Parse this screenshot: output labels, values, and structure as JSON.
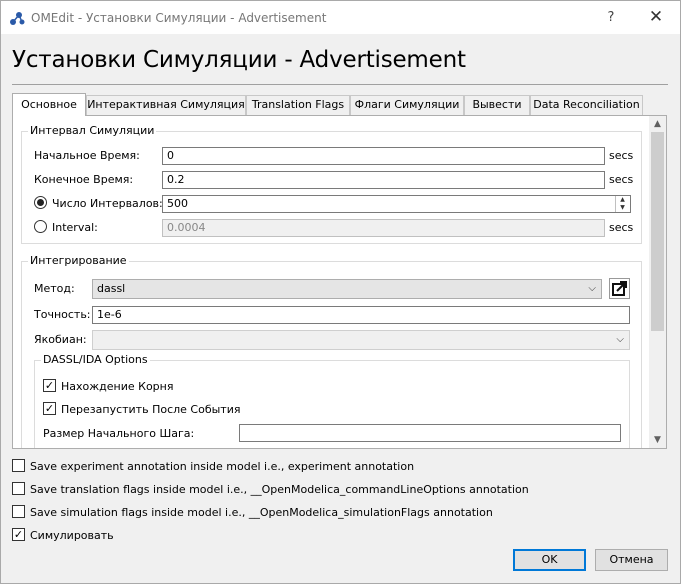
{
  "window": {
    "title": "OMEdit - Установки Симуляции - Advertisement",
    "help_label": "?",
    "close_label": "✕"
  },
  "heading": "Установки Симуляции - Advertisement",
  "tabs": [
    {
      "label": "Основное",
      "active": true
    },
    {
      "label": "Интерактивная Симуляция"
    },
    {
      "label": "Translation Flags"
    },
    {
      "label": "Флаги Симуляции"
    },
    {
      "label": "Вывести"
    },
    {
      "label": "Data Reconciliation"
    }
  ],
  "interval_group": {
    "title": "Интервал Симуляции",
    "start_time": {
      "label": "Начальное Время:",
      "value": "0",
      "unit": "secs"
    },
    "stop_time": {
      "label": "Конечное Время:",
      "value": "0.2",
      "unit": "secs"
    },
    "num_intervals": {
      "label": "Число Интервалов:",
      "value": "500",
      "selected": true
    },
    "interval": {
      "label": "Interval:",
      "value": "0.0004",
      "unit": "secs",
      "selected": false
    }
  },
  "integration_group": {
    "title": "Интегрирование",
    "method": {
      "label": "Метод:",
      "value": "dassl"
    },
    "tolerance": {
      "label": "Точность:",
      "value": "1e-6"
    },
    "jacobian": {
      "label": "Якобиан:",
      "value": ""
    },
    "dassl_group": {
      "title": "DASSL/IDA Options",
      "root_finding": {
        "label": "Нахождение Корня",
        "checked": true
      },
      "restart_after_event": {
        "label": "Перезапустить После События",
        "checked": true
      },
      "initial_step_size": {
        "label": "Размер Начального Шага:",
        "value": ""
      }
    }
  },
  "options": [
    {
      "label": "Save experiment annotation inside model i.e., experiment annotation",
      "checked": false
    },
    {
      "label": "Save translation flags inside model i.e., __OpenModelica_commandLineOptions annotation",
      "checked": false
    },
    {
      "label": "Save simulation flags inside model i.e., __OpenModelica_simulationFlags annotation",
      "checked": false
    },
    {
      "label": "Симулировать",
      "checked": true
    }
  ],
  "buttons": {
    "ok": "OK",
    "cancel": "Отмена"
  },
  "check_glyph": "✓",
  "colors": {
    "accent": "#0078d7"
  }
}
